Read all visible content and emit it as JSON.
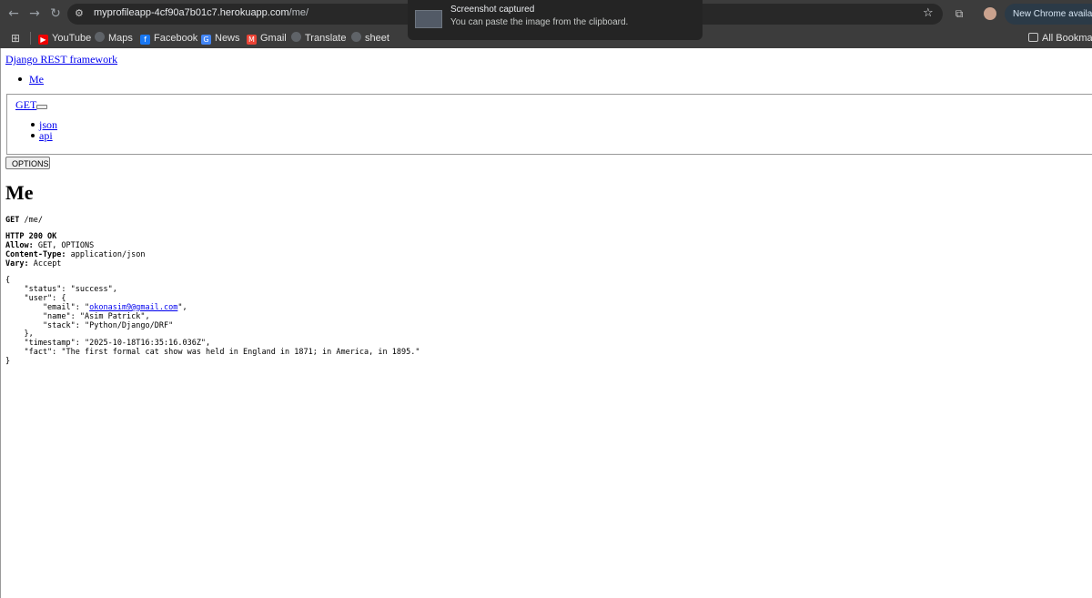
{
  "browser": {
    "url_host": "myprofileapp-4cf90a7b01c7.herokuapp.com",
    "url_path": "/me/",
    "new_chrome_label": "New Chrome available",
    "bookmarks": [
      "YouTube",
      "Maps",
      "Facebook",
      "News",
      "Gmail",
      "Translate",
      "sheet"
    ],
    "all_bookmarks": "All Bookmarks",
    "colors": {
      "frame": "#3c3c3c",
      "omnibox": "#282828"
    }
  },
  "toast": {
    "title": "Screenshot captured",
    "subtitle": "You can paste the image from the clipboard."
  },
  "page": {
    "brand": "Django REST framework",
    "breadcrumb": "Me",
    "get_link": "GET",
    "formats": [
      "json",
      "api"
    ],
    "options_button": "OPTIONS",
    "heading": "Me",
    "request": {
      "method": "GET",
      "path": "/me/"
    },
    "response": {
      "status": "HTTP 200 OK",
      "headers": [
        {
          "key": "Allow:",
          "value": "GET, OPTIONS"
        },
        {
          "key": "Content-Type:",
          "value": "application/json"
        },
        {
          "key": "Vary:",
          "value": "Accept"
        }
      ]
    },
    "json_lines": {
      "open": "{",
      "status": "    \"status\": \"success\",",
      "user_open": "    \"user\": {",
      "email_prefix": "        \"email\": \"",
      "email": "okonasim9@gmail.com",
      "email_suffix": "\",",
      "name": "        \"name\": \"Asim Patrick\",",
      "stack": "        \"stack\": \"Python/Django/DRF\"",
      "user_close": "    },",
      "timestamp": "    \"timestamp\": \"2025-10-18T16:35:16.036Z\",",
      "fact": "    \"fact\": \"The first formal cat show was held in England in 1871; in America, in 1895.\"",
      "close": "}"
    }
  }
}
